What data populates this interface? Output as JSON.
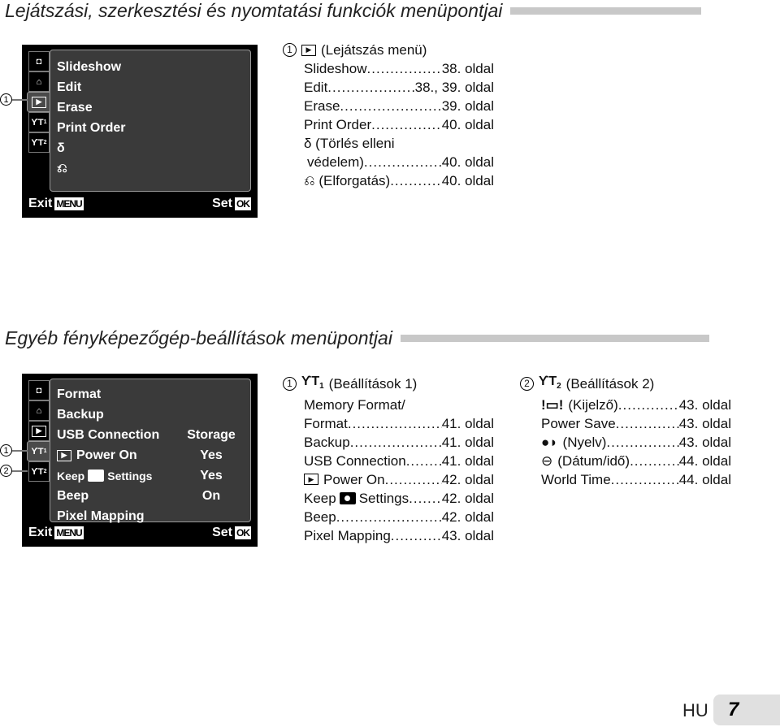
{
  "section1": {
    "title": "Lejátszási, szerkesztési és nyomtatási funkciók menüpontjai",
    "screen": {
      "tabs": [
        "camera-icon",
        "movie-icon",
        "playback-icon",
        "setup1-icon",
        "setup2-icon"
      ],
      "tab_labels": [
        "◘",
        "⌂",
        "▶",
        "ϒT1",
        "ϒT2"
      ],
      "active_tab": 2,
      "items": [
        {
          "label": "Slideshow",
          "value": ""
        },
        {
          "label": "Edit",
          "value": ""
        },
        {
          "label": "Erase",
          "value": ""
        },
        {
          "label": "Print Order",
          "value": ""
        },
        {
          "label": "δ",
          "icon": "protect-icon",
          "value": ""
        },
        {
          "label": "⎌",
          "icon": "rotate-icon",
          "value": ""
        }
      ],
      "exit_label": "Exit",
      "exit_key": "MENU",
      "set_label": "Set",
      "set_key": "OK"
    },
    "callouts": [
      "1"
    ],
    "reference": {
      "header_num": "1",
      "header_text": "(Lejátszás menü)",
      "rows": [
        {
          "name": "Slideshow",
          "page": "38. oldal"
        },
        {
          "name": "Edit",
          "page": "38., 39. oldal"
        },
        {
          "name": "Erase",
          "page": "39. oldal"
        },
        {
          "name": "Print Order",
          "page": "40. oldal"
        },
        {
          "name": "δ (Törlés elleni",
          "page": ""
        },
        {
          "name": "védelem)",
          "page": "40. oldal"
        },
        {
          "name": "⎌ (Elforgatás)",
          "page": "40. oldal"
        }
      ]
    }
  },
  "section2": {
    "title": "Egyéb fényképezőgép-beállítások menüpontjai",
    "screen": {
      "tab_labels": [
        "◘",
        "⌂",
        "▶",
        "ϒT1",
        "ϒT2"
      ],
      "active_tab": 3,
      "items": [
        {
          "label": "Format",
          "value": ""
        },
        {
          "label": "Backup",
          "value": ""
        },
        {
          "label": "USB Connection",
          "value": "Storage"
        },
        {
          "label": "Power On",
          "prefix_icon": "playback-icon",
          "value": "Yes"
        },
        {
          "label_pre": "Keep",
          "label_post": "Settings",
          "value": "Yes"
        },
        {
          "label": "Beep",
          "value": "On"
        },
        {
          "label": "Pixel Mapping",
          "value": ""
        }
      ],
      "exit_label": "Exit",
      "exit_key": "MENU",
      "set_label": "Set",
      "set_key": "OK"
    },
    "callouts": [
      "1",
      "2"
    ],
    "reference1": {
      "header_num": "1",
      "header_icon": "ϒT",
      "header_sub": "1",
      "header_text": "(Beállítások 1)",
      "rows": [
        {
          "name": "Memory Format/",
          "page": ""
        },
        {
          "name": "Format",
          "page": "41. oldal"
        },
        {
          "name": "Backup",
          "page": "41. oldal"
        },
        {
          "name": "USB Connection",
          "page": "41. oldal"
        },
        {
          "name": "Power On",
          "page": "42. oldal"
        },
        {
          "name_pre": "Keep",
          "name_post": "Settings",
          "page": "42. oldal"
        },
        {
          "name": "Beep",
          "page": "42. oldal"
        },
        {
          "name": "Pixel Mapping",
          "page": "43. oldal"
        }
      ]
    },
    "reference2": {
      "header_num": "2",
      "header_icon": "ϒT",
      "header_sub": "2",
      "header_text": "(Beállítások 2)",
      "rows": [
        {
          "icon": "!▭!",
          "name": "(Kijelző)",
          "page": "43. oldal"
        },
        {
          "icon": "",
          "name": "Power Save",
          "page": "43. oldal"
        },
        {
          "icon": "●◗",
          "name": "(Nyelv)",
          "page": "43. oldal"
        },
        {
          "icon": "⊖",
          "name": "(Dátum/idő)",
          "page": "44. oldal"
        },
        {
          "icon": "",
          "name": "World Time",
          "page": "44. oldal"
        }
      ]
    }
  },
  "footer": {
    "lang": "HU",
    "page_number": "7"
  }
}
